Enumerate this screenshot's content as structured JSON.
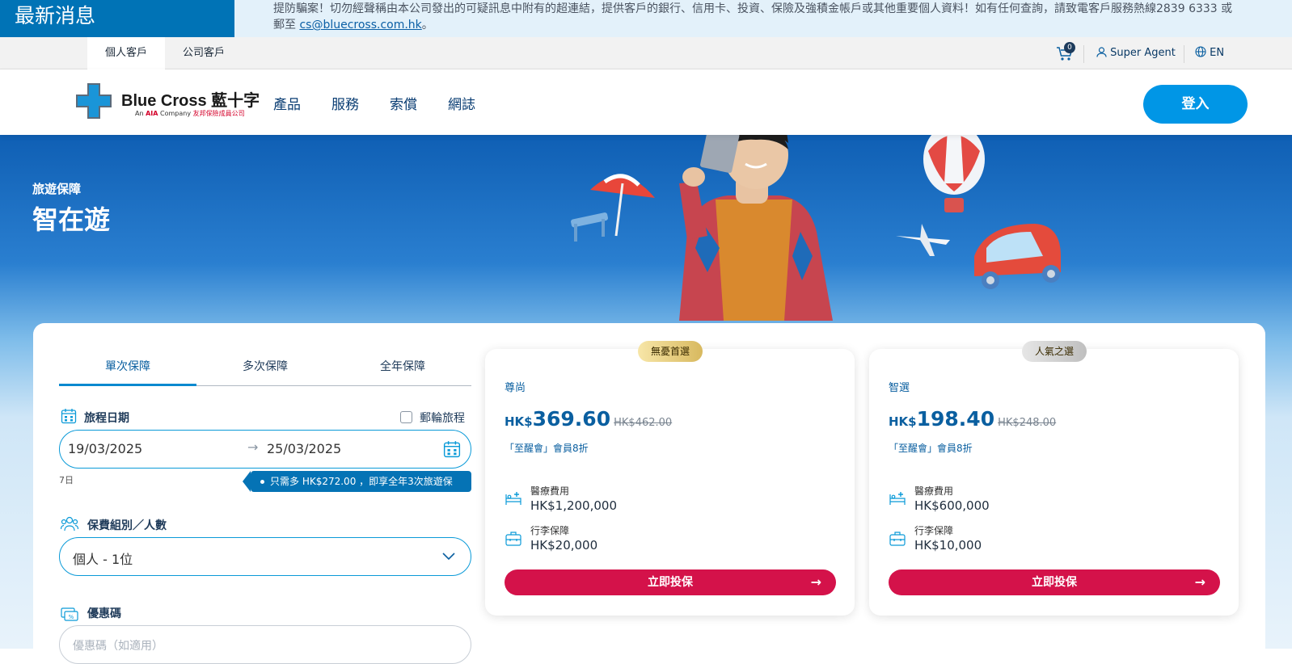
{
  "news": {
    "label": "最新消息",
    "text": "提防騙案！切勿經聲稱由本公司發出的可疑訊息中附有的超連結，提供客戶的銀行、信用卡、投資、保險及強積金帳戶或其他重要個人資料！如有任何查詢，請致電客戶服務熱線2839 6333 或",
    "text2": "郵至 ",
    "email": "cs@bluecross.com.hk",
    "suffix": "。"
  },
  "subnav": {
    "tabs": [
      {
        "label": "個人客戶"
      },
      {
        "label": "公司客戶"
      }
    ],
    "cart_count": "0",
    "agent": "Super Agent",
    "lang": "EN"
  },
  "header": {
    "logo_title": "Blue Cross 藍十字",
    "logo_sub_pre": "An ",
    "logo_sub_aia": "AIA",
    "logo_sub_post": " Company",
    "logo_sub_cn": "友邦保險成員公司",
    "nav": [
      {
        "label": "產品"
      },
      {
        "label": "服務"
      },
      {
        "label": "索償"
      },
      {
        "label": "網誌"
      }
    ],
    "login": "登入"
  },
  "hero": {
    "subtitle": "旅遊保障",
    "title": "智在遊"
  },
  "form": {
    "tabs": [
      {
        "label": "單次保障"
      },
      {
        "label": "多次保障"
      },
      {
        "label": "全年保障"
      }
    ],
    "trip_date_label": "旅程日期",
    "cruise_label": "郵輪旅程",
    "date_from": "19/03/2025",
    "date_arrow": "→",
    "date_to": "25/03/2025",
    "days": "7日",
    "promo": "只需多 HK$272.00 ，即享全年3次旅遊保障！",
    "group_label": "保費組別／人數",
    "group_value": "個人 - 1位",
    "coupon_label": "優惠碼",
    "coupon_placeholder": "優惠碼（如適用）"
  },
  "plans": [
    {
      "badge": "無憂首選",
      "name": "尊尚",
      "currency": "HK$",
      "price": "369.60",
      "orig_currency": "HK$",
      "orig_price": "462.00",
      "member": "「至醒會」會員8折",
      "medical_label": "醫療費用",
      "medical_value": "HK$1,200,000",
      "baggage_label": "行李保障",
      "baggage_value": "HK$20,000",
      "apply": "立即投保"
    },
    {
      "badge": "人氣之選",
      "name": "智選",
      "currency": "HK$",
      "price": "198.40",
      "orig_currency": "HK$",
      "orig_price": "248.00",
      "member": "「至醒會」會員8折",
      "medical_label": "醫療費用",
      "medical_value": "HK$600,000",
      "baggage_label": "行李保障",
      "baggage_value": "HK$10,000",
      "apply": "立即投保"
    }
  ],
  "colors": {
    "brand_blue": "#0073b6",
    "accent_red": "#d4124a",
    "badge_gold": "#e2c878",
    "badge_grey": "#c9c9c9"
  }
}
